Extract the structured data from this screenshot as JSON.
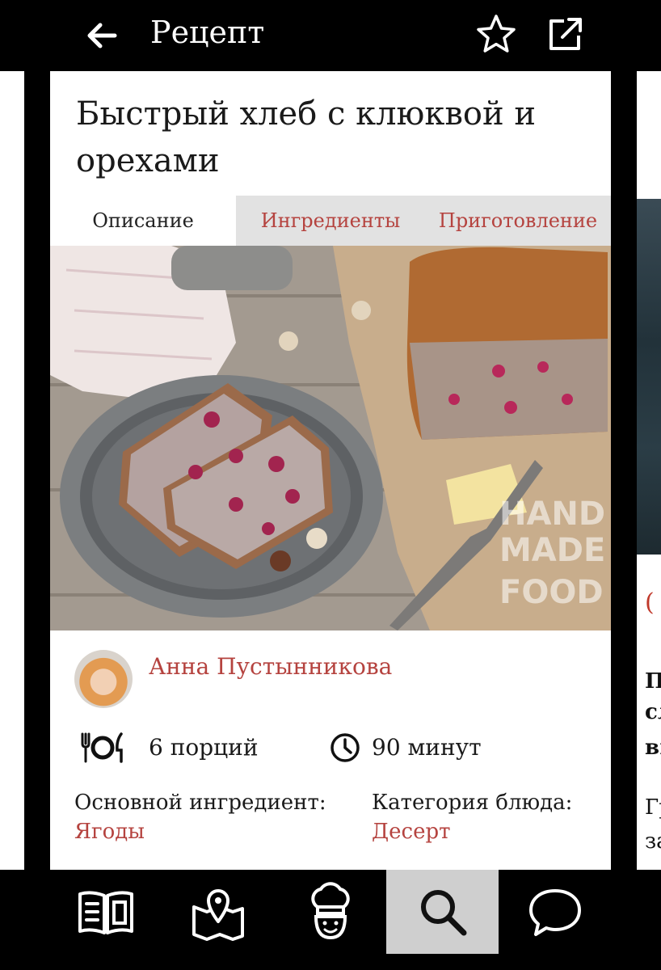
{
  "topbar": {
    "title": "Рецепт",
    "back_icon": "arrow-left-icon",
    "favorite_icon": "star-icon",
    "share_icon": "external-share-icon"
  },
  "recipe": {
    "title": "Быстрый хлеб с клюквой и орехами",
    "tabs": [
      {
        "label": "Описание",
        "active": true
      },
      {
        "label": "Ингредиенты",
        "active": false
      },
      {
        "label": "Приготовление",
        "active": false
      }
    ],
    "photo_watermark": [
      "HAND",
      "MADE",
      "FOOD"
    ],
    "author": "Анна Пустынникова",
    "servings": "6 порций",
    "time": "90 минут",
    "main_ingredient_label": "Основной ингредиент:",
    "main_ingredient_value": "Ягоды",
    "category_label": "Категория блюда:",
    "category_value": "Десерт"
  },
  "side_peek_text": {
    "line1": "П",
    "line2": "сл",
    "line3": "вь",
    "line4": "Гр",
    "line5": "за"
  },
  "bottom_nav": [
    {
      "icon": "book-icon",
      "active": false
    },
    {
      "icon": "map-pin-icon",
      "active": false
    },
    {
      "icon": "chef-icon",
      "active": false
    },
    {
      "icon": "search-icon",
      "active": true
    },
    {
      "icon": "chat-bubble-icon",
      "active": false
    }
  ],
  "colors": {
    "accent": "#b5433f",
    "tab_bar": "#e2e2e2",
    "nav_active": "#cfcfcf",
    "chrome": "#000000"
  }
}
